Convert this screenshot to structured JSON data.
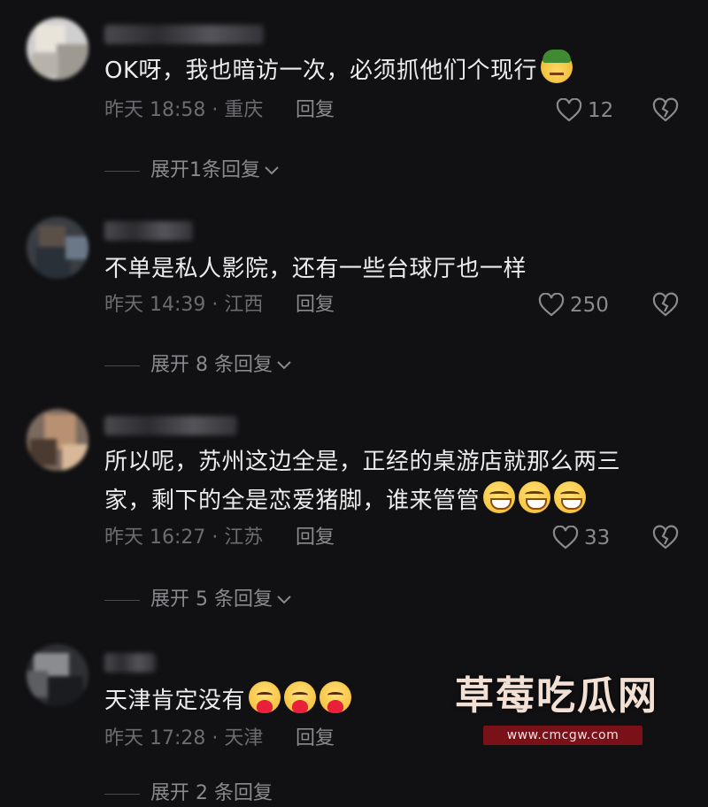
{
  "comments": [
    {
      "text": "OK呀，我也暗访一次，必须抓他们个现行",
      "emoji": [
        "army-face"
      ],
      "meta": "昨天 18:58 · 重庆",
      "reply_label": "回复",
      "likes": "12",
      "expand": "展开1条回复"
    },
    {
      "text": "不单是私人影院，还有一些台球厅也一样",
      "emoji": [],
      "meta": "昨天 14:39 · 江西",
      "reply_label": "回复",
      "likes": "250",
      "expand": "展开 8 条回复"
    },
    {
      "text_line1": "所以呢，苏州这边全是，正经的桌游店就那么两三",
      "text_line2": "家，剩下的全是恋爱猪脚，谁来管管",
      "emoji": [
        "grin-sweat",
        "grin-sweat",
        "grin-sweat"
      ],
      "meta": "昨天 16:27 · 江苏",
      "reply_label": "回复",
      "likes": "33",
      "expand": "展开 5 条回复"
    },
    {
      "text": "天津肯定没有",
      "emoji": [
        "face-holding-heart",
        "face-holding-heart",
        "face-holding-heart"
      ],
      "meta": "昨天 17:28 · 天津",
      "reply_label": "回复",
      "expand": "展开 2 条回复"
    }
  ],
  "watermark": {
    "title": "草莓吃瓜网",
    "url": "www.cmcgw.com"
  },
  "colors": {
    "background": "#111113",
    "text": "#ececec",
    "meta": "#6c6c70",
    "secondary": "#8a8a8e"
  }
}
